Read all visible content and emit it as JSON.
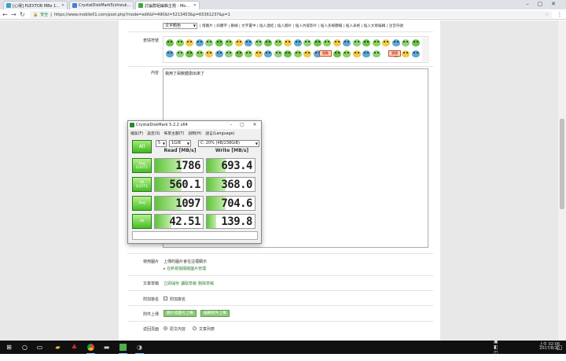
{
  "browser": {
    "tabs": [
      {
        "title": "[心得] PLEXTOR M8e 1..."
      },
      {
        "title": "CrystalDiskMark5(shizuk..."
      },
      {
        "title": "討論群組編輯主題 - Mo..."
      }
    ],
    "url_secure_label": "安全",
    "url": "https://www.mobile01.com/post.php?mode=edit&f=490&t=5213453&p=65361237&p=1"
  },
  "editor": {
    "font_select": "文字顏色",
    "toolbar_links": "| 增圖片 | 斜體字 | 刪線 | 文字置中 | 插入連結 | 插入圖片 | 插入內嵌影片 | 插入多媒體檔 | 插入表格 | 插入文章編輯 | 注音符號",
    "emoji_label": "表情符號",
    "emoji_stamp_1": "開動",
    "emoji_stamp_2": "讚讚",
    "content_label": "內容",
    "content_text": "我用了兩軟體測出來了"
  },
  "cdm": {
    "title": "CrystalDiskMark 5.2.2 x64",
    "menu": [
      "檔案(F)",
      "設定(S)",
      "佈景主題(T)",
      "說明(H)",
      "語言(Language)"
    ],
    "all_label": "All",
    "count": "5",
    "size": "1GiB",
    "drive": "C: 20% (4B/238GiB)",
    "read_header": "Read [MB/s]",
    "write_header": "Write [MB/s]",
    "tests": [
      {
        "label": "Seq",
        "sub": "Q32T1",
        "read": "1786",
        "write": "693.4",
        "read_frac": 0.55,
        "write_frac": 0.4
      },
      {
        "label": "4K",
        "sub": "Q32T1",
        "read": "560.1",
        "write": "368.0",
        "read_frac": 0.55,
        "write_frac": 0.4
      },
      {
        "label": "Seq",
        "sub": "",
        "read": "1097",
        "write": "704.6",
        "read_frac": 0.55,
        "write_frac": 0.4
      },
      {
        "label": "4K",
        "sub": "",
        "read": "42.51",
        "write": "139.8",
        "read_frac": 0.35,
        "write_frac": 0.2
      }
    ]
  },
  "form": {
    "use_image_label": "使用圖片",
    "use_image_text": "上傳的圖片會在這裡顯示",
    "use_image_link": "▸ 在新視窗開啟圖片管理",
    "article_edit_label": "文章草稿",
    "draft_links": [
      "立即儲存",
      "讀取草稿",
      "刪除草稿"
    ],
    "signature_label": "附加簽名",
    "signature_checkbox": "附加簽名",
    "attach_label": "附件上傳",
    "attach_btn_1": "圖片或圖片上傳",
    "attach_btn_2": "編輯附件上傳",
    "return_label": "返回頁面",
    "return_opt_1": "原文內容",
    "return_opt_2": "文章列表"
  },
  "taskbar": {
    "time": "上午 02:06",
    "date": "2017/8/10"
  }
}
